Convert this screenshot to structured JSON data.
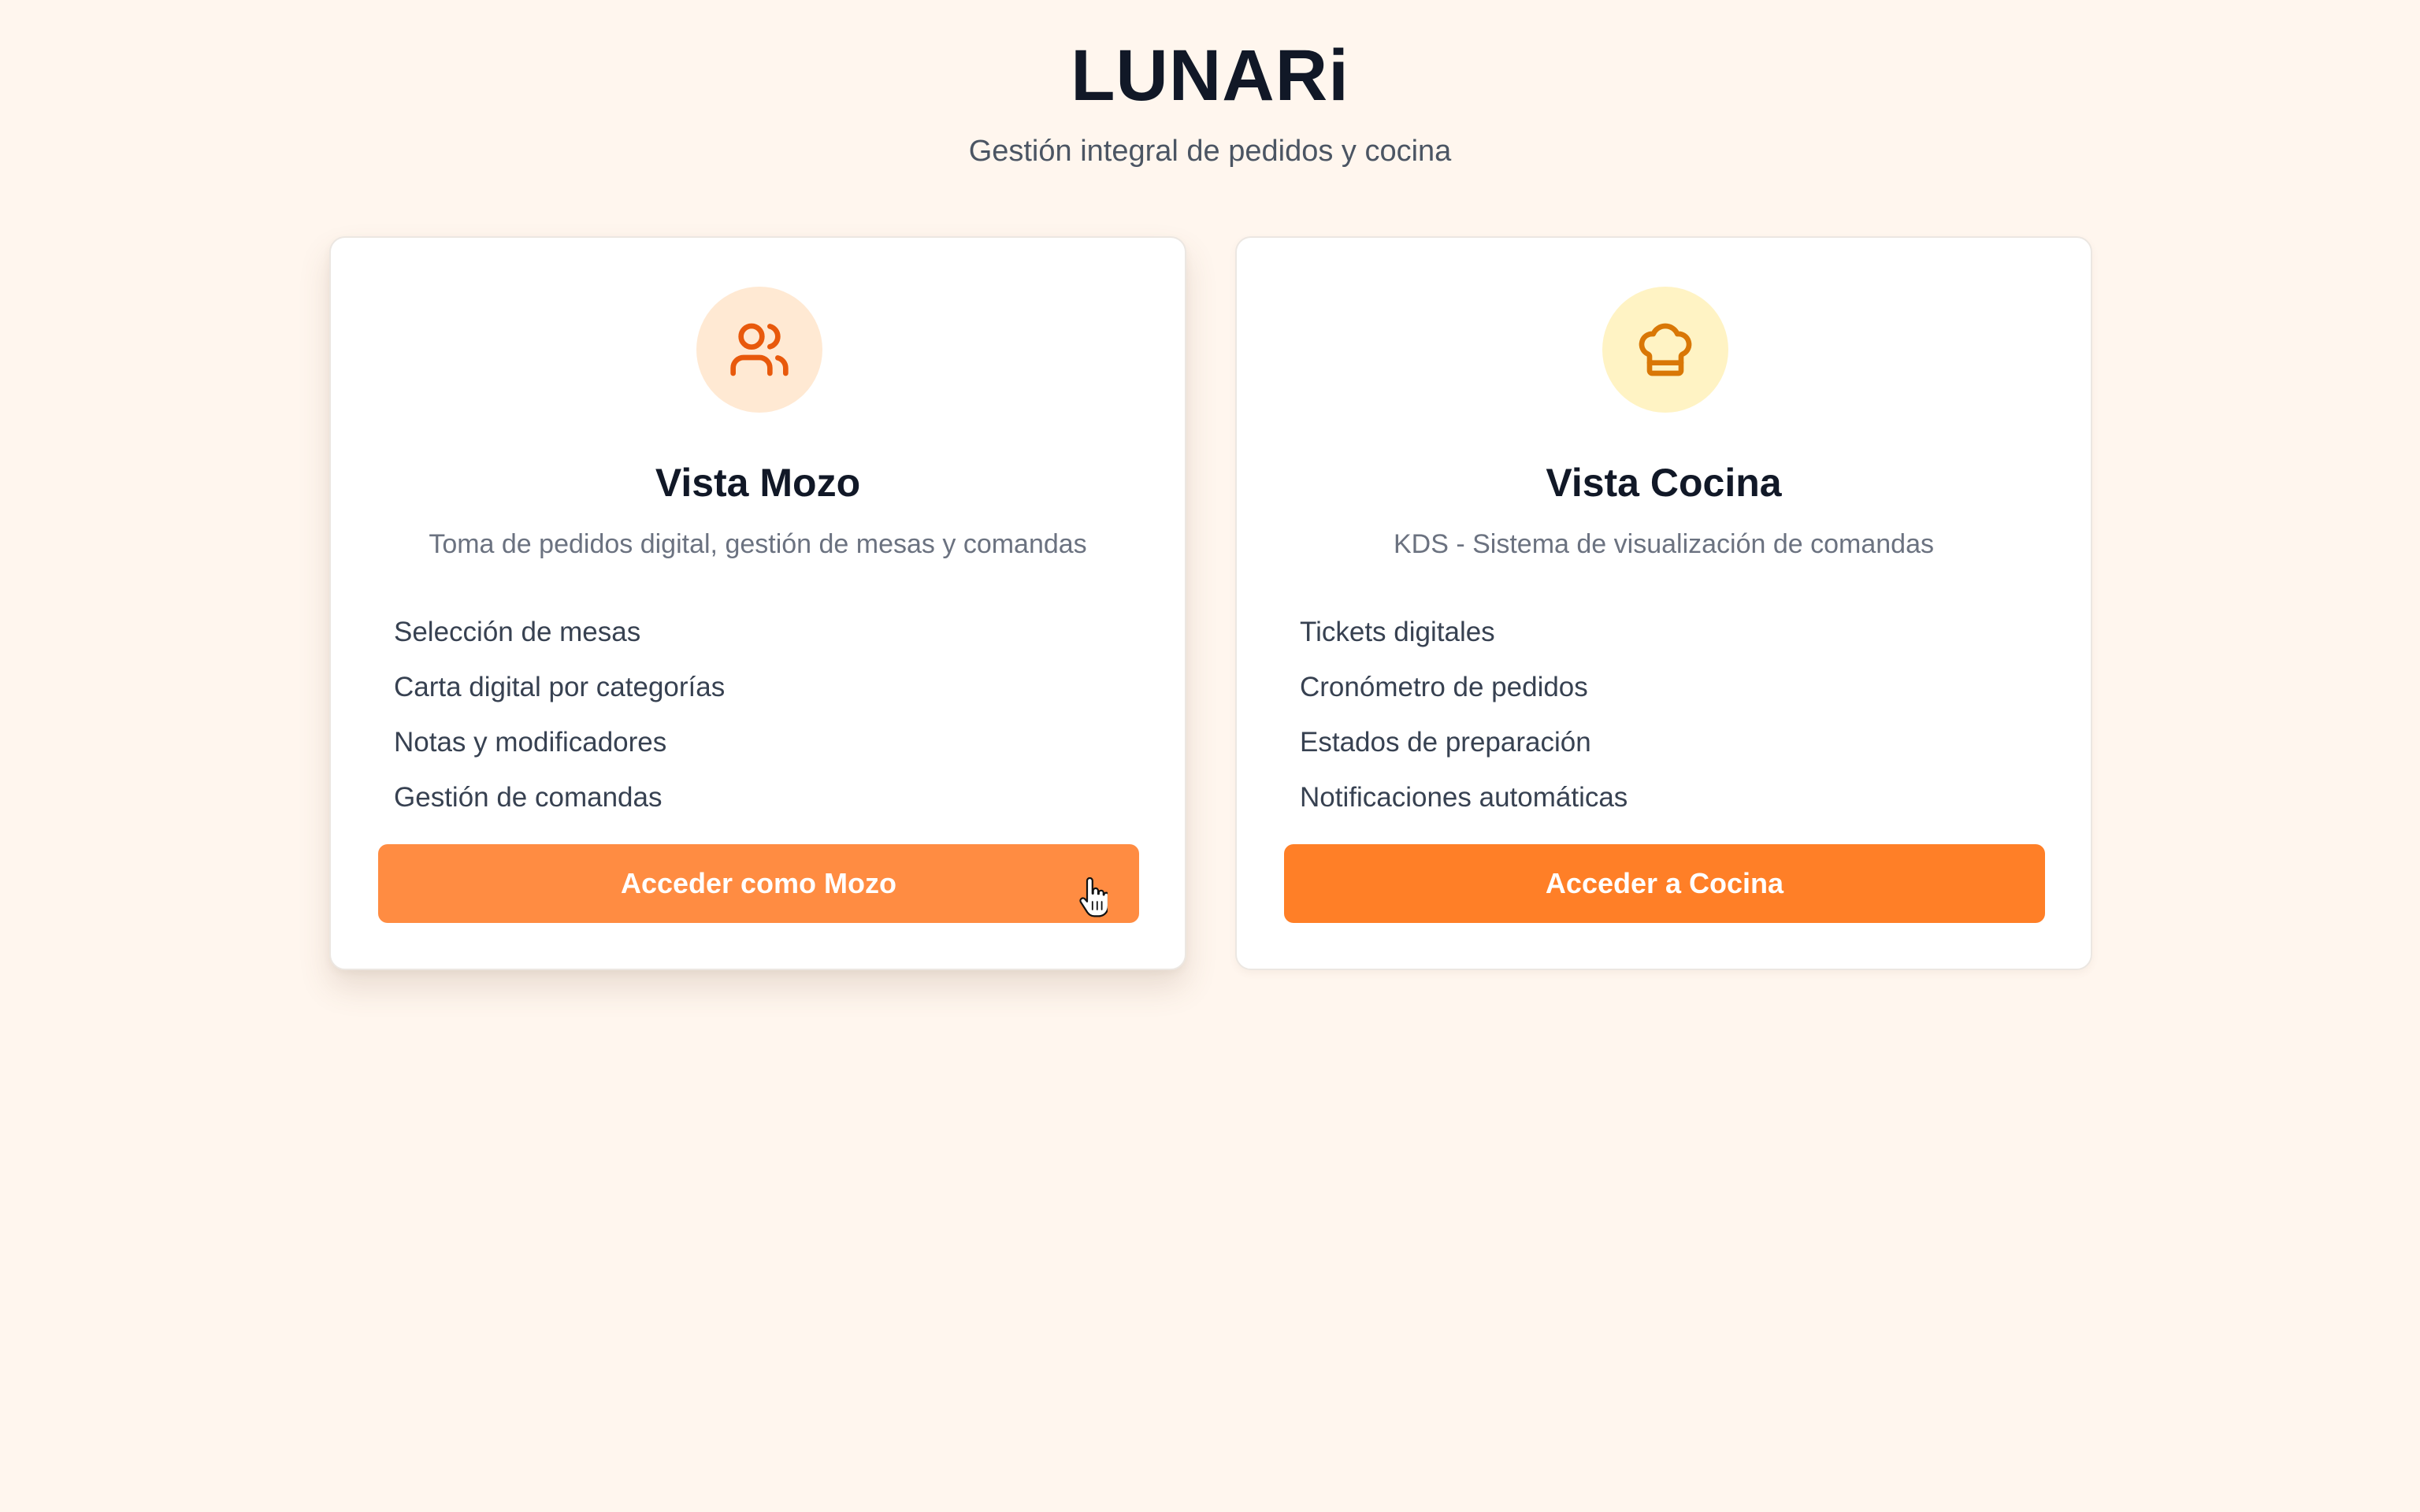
{
  "header": {
    "title": "LUNARi",
    "subtitle": "Gestión integral de pedidos y cocina"
  },
  "cards": [
    {
      "icon": "users-icon",
      "title": "Vista Mozo",
      "description": "Toma de pedidos digital, gestión de mesas y comandas",
      "features": [
        "Selección de mesas",
        "Carta digital por categorías",
        "Notas y modificadores",
        "Gestión de comandas"
      ],
      "button_label": "Acceder como Mozo",
      "accent": "#ff8c42",
      "icon_color": "#e8590c"
    },
    {
      "icon": "chef-hat-icon",
      "title": "Vista Cocina",
      "description": "KDS - Sistema de visualización de comandas",
      "features": [
        "Tickets digitales",
        "Cronómetro de pedidos",
        "Estados de preparación",
        "Notificaciones automáticas"
      ],
      "button_label": "Acceder a Cocina",
      "accent": "#ff7f27",
      "icon_color": "#d97706"
    }
  ],
  "colors": {
    "background": "#fff6ee",
    "waiter_icon_bg": "#ffe9d3",
    "kitchen_icon_bg": "#fff3c4"
  }
}
